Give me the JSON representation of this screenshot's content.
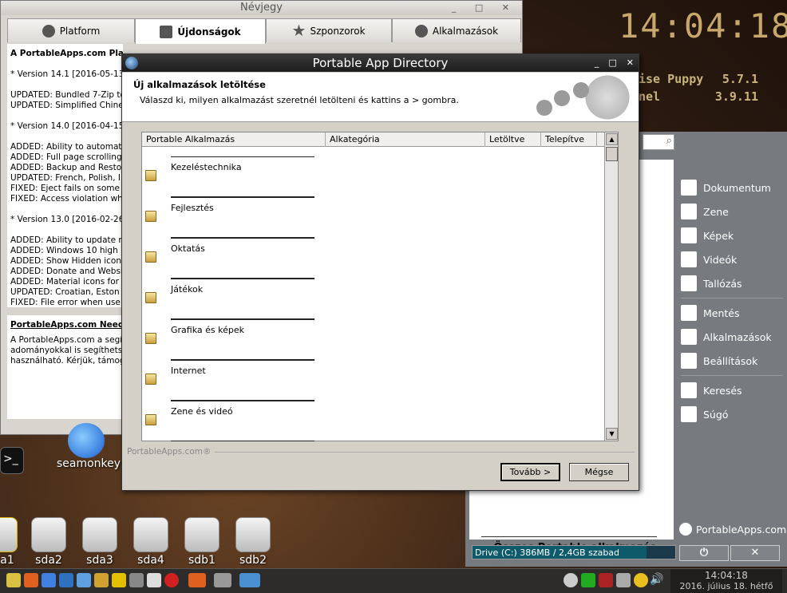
{
  "desktop": {
    "clock": "14:04:18",
    "sysinfo": [
      {
        "label": "ise Puppy",
        "value": "5.7.1"
      },
      {
        "label": "nel",
        "value": "3.9.11"
      }
    ],
    "drive_icons": [
      "a1",
      "sda2",
      "sda3",
      "sda4",
      "sdb1",
      "sdb2"
    ],
    "seamonkey_label": "seamonkey"
  },
  "nevjegy": {
    "title": "Névjegy",
    "tabs": [
      "Platform",
      "Újdonságok",
      "Szponzorok",
      "Alkalmazások"
    ],
    "heading": "A PortableApps.com Platform újdonságai:",
    "lines": [
      "* Version 14.1 [2016-05-13",
      "",
      "UPDATED: Bundled 7-Zip to",
      "UPDATED: Simplified Chines",
      "",
      "* Version 14.0 [2016-04-15",
      "",
      "ADDED: Ability to automati",
      "ADDED: Full page scrolling",
      "ADDED: Backup and Restor",
      "UPDATED: French, Polish, I",
      "FIXED: Eject fails on some",
      "FIXED: Access violation wh",
      "",
      "* Version 13.0 [2016-02-26",
      "",
      "ADDED: Ability to update m",
      "ADDED: Windows 10 high D",
      "ADDED: Show Hidden icons",
      "ADDED: Donate and Websi",
      "ADDED: Material icons for i",
      "UPDATED: Croatian, Eston",
      "FIXED: File error when use"
    ],
    "needs_heading": "PortableApps.com Need",
    "needs_lines": [
      "A PortableApps.com a segí",
      "adományokkal is segíthetsz, a",
      "használható. Kérjük, támog"
    ]
  },
  "pamenu": {
    "all_apps": "Összes Portable alkalmazás",
    "side_items_1": [
      "Dokumentum",
      "Zene",
      "Képek",
      "Videók",
      "Tallózás"
    ],
    "side_items_2": [
      "Mentés",
      "Alkalmazások",
      "Beállítások"
    ],
    "side_items_3": [
      "Keresés",
      "Súgó"
    ],
    "side_icons_1": [
      "document-icon",
      "music-icon",
      "pictures-icon",
      "video-icon",
      "folder-icon"
    ],
    "side_icons_2": [
      "backup-icon",
      "apps-icon",
      "gear-icon"
    ],
    "side_icons_3": [
      "search-icon",
      "help-icon"
    ],
    "brand": "PortableApps.com",
    "drive": "Drive (C:) 386MB / 2,4GB szabad",
    "drive_fill_fraction": 0.86,
    "power_symbol": "⏻",
    "close_symbol": "✕"
  },
  "dialog": {
    "title": "Portable App Directory",
    "header_title": "Új alkalmazások letöltése",
    "header_text": "Válaszd ki, milyen alkalmazást szeretnél letölteni és kattins a > gombra.",
    "columns": [
      "Portable Alkalmazás",
      "Alkategória",
      "Letöltve",
      "Telepítve"
    ],
    "categories": [
      "Kezeléstechnika",
      "Fejlesztés",
      "Oktatás",
      "Játékok",
      "Grafika és képek",
      "Internet",
      "Zene és videó"
    ],
    "brand": "PortableApps.com®",
    "next_button": "Tovább >",
    "cancel_button": "Mégse"
  },
  "taskbar": {
    "time": "14:04:18",
    "date": "2016. július 18. hétfő"
  }
}
